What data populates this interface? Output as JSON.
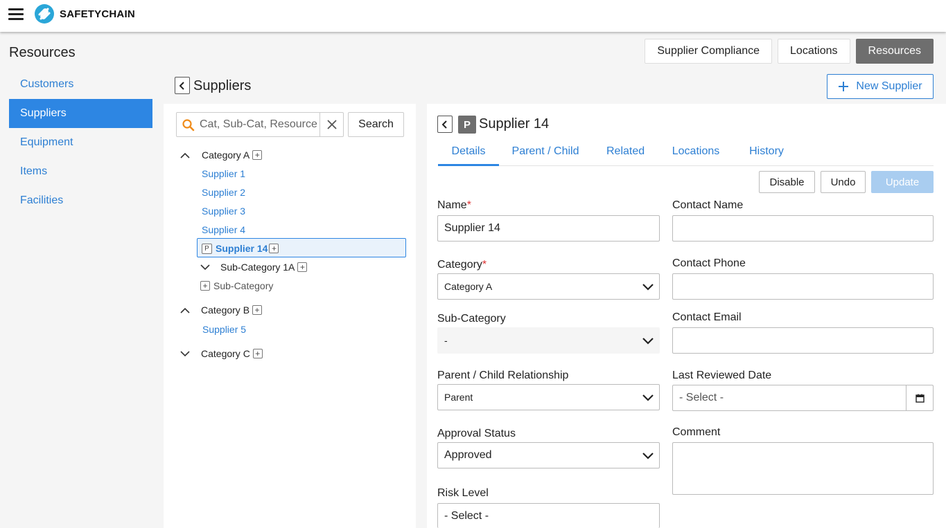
{
  "brand": {
    "logo_text": "SAFETYCHAIN"
  },
  "page": {
    "title": "Resources"
  },
  "top_buttons": [
    {
      "label": "Supplier Compliance",
      "active": false
    },
    {
      "label": "Locations",
      "active": false
    },
    {
      "label": "Resources",
      "active": true
    }
  ],
  "left_nav": [
    {
      "label": "Customers",
      "active": false
    },
    {
      "label": "Suppliers",
      "active": true
    },
    {
      "label": "Equipment",
      "active": false
    },
    {
      "label": "Items",
      "active": false
    },
    {
      "label": "Facilities",
      "active": false
    }
  ],
  "section": {
    "title": "Suppliers",
    "new_button": "New Supplier"
  },
  "search": {
    "placeholder": "Cat, Sub-Cat, Resource",
    "button": "Search"
  },
  "tree": {
    "category_a": "Category A",
    "suppliers_a": [
      "Supplier 1",
      "Supplier 2",
      "Supplier 3",
      "Supplier 4"
    ],
    "selected_badge": "P",
    "selected": "Supplier 14",
    "subcategory_1a": "Sub-Category 1A",
    "add_subcategory": "Sub-Category",
    "category_b": "Category B",
    "suppliers_b": [
      "Supplier 5"
    ],
    "category_c": "Category C"
  },
  "detail": {
    "badge": "P",
    "title": "Supplier 14",
    "tabs": [
      "Details",
      "Parent / Child",
      "Related",
      "Locations",
      "History"
    ],
    "actions": {
      "disable": "Disable",
      "undo": "Undo",
      "update": "Update"
    },
    "fields": {
      "name_label": "Name",
      "name_value": "Supplier 14",
      "category_label": "Category",
      "category_value": "Category A",
      "subcategory_label": "Sub-Category",
      "subcategory_value": "-",
      "relationship_label": "Parent / Child Relationship",
      "relationship_value": "Parent",
      "approval_label": "Approval Status",
      "approval_value": "Approved",
      "risk_label": "Risk Level",
      "risk_value": "- Select -",
      "contact_name_label": "Contact Name",
      "contact_phone_label": "Contact Phone",
      "contact_email_label": "Contact Email",
      "reviewed_label": "Last Reviewed Date",
      "reviewed_placeholder": "- Select -",
      "comment_label": "Comment"
    }
  },
  "colors": {
    "accent": "#2d86e3",
    "link": "#2d7fd3",
    "active_top_button": "#6e6e6e",
    "required": "#d33333",
    "update_disabled": "#a9cdf0"
  }
}
